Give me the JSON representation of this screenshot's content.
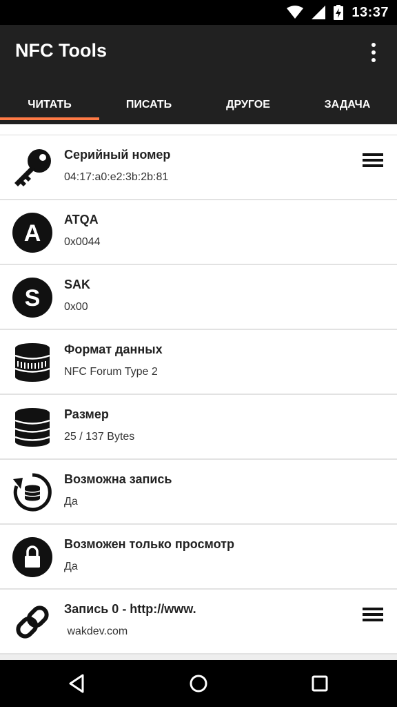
{
  "status_bar": {
    "time": "13:37",
    "icons": [
      "wifi-icon",
      "cell-signal-icon",
      "battery-charging-icon"
    ]
  },
  "app_bar": {
    "title": "NFC Tools",
    "overflow_icon": "more-vertical-icon"
  },
  "tabs": [
    {
      "label": "ЧИТАТЬ",
      "active": true
    },
    {
      "label": "ПИСАТЬ",
      "active": false
    },
    {
      "label": "ДРУГОЕ",
      "active": false
    },
    {
      "label": "ЗАДАЧА",
      "active": false
    }
  ],
  "items": [
    {
      "icon": "key-icon",
      "title": "Серийный номер",
      "value": "04:17:a0:e2:3b:2b:81",
      "has_menu": true
    },
    {
      "icon": "letter-a-icon",
      "title": "ATQA",
      "value": "0x0044",
      "has_menu": false
    },
    {
      "icon": "letter-s-icon",
      "title": "SAK",
      "value": "0x00",
      "has_menu": false
    },
    {
      "icon": "database-format-icon",
      "title": "Формат данных",
      "value": "NFC Forum Type 2",
      "has_menu": false
    },
    {
      "icon": "database-icon",
      "title": "Размер",
      "value": "25 / 137 Bytes",
      "has_menu": false
    },
    {
      "icon": "database-rewrite-icon",
      "title": "Возможна запись",
      "value": "Да",
      "has_menu": false
    },
    {
      "icon": "lock-icon",
      "title": "Возможен только просмотр",
      "value": "Да",
      "has_menu": false
    },
    {
      "icon": "link-icon",
      "title": "Запись 0 - http://www.",
      "value": " wakdev.com",
      "has_menu": true
    }
  ],
  "nav_bar": {
    "icons": [
      "back-icon",
      "home-icon",
      "recents-icon"
    ]
  },
  "colors": {
    "app_bar": "#212121",
    "tab_indicator": "#ff7a45",
    "status_bar": "#000000"
  }
}
